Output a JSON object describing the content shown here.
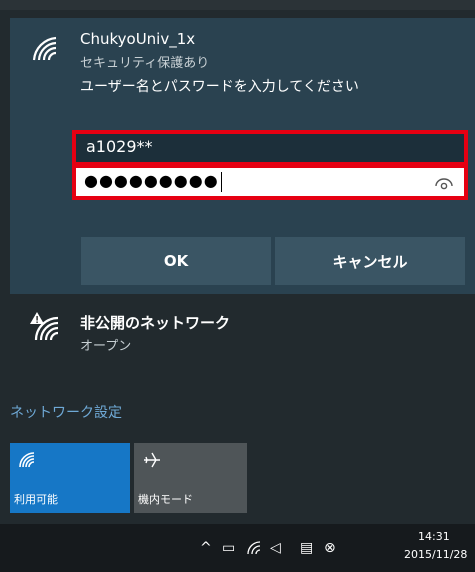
{
  "selected_network": {
    "ssid": "ChukyoUniv_1x",
    "security": "セキュリティ保護あり",
    "prompt": "ユーザー名とパスワードを入力してください",
    "username_value": "a1029**",
    "password_mask": "●●●●●●●●●",
    "ok_label": "OK",
    "cancel_label": "キャンセル"
  },
  "other_network": {
    "name": "非公開のネットワーク",
    "status": "オープン"
  },
  "settings_link": "ネットワーク設定",
  "quick_actions": [
    {
      "label": "利用可能",
      "icon": "wifi-icon",
      "active": true
    },
    {
      "label": "機内モード",
      "icon": "airplane-icon",
      "active": false
    }
  ],
  "taskbar": {
    "time": "14:31",
    "date": "2015/11/28"
  },
  "colors": {
    "highlight_border": "#e60012",
    "accent": "#1677c6",
    "link": "#6fa9d6"
  }
}
